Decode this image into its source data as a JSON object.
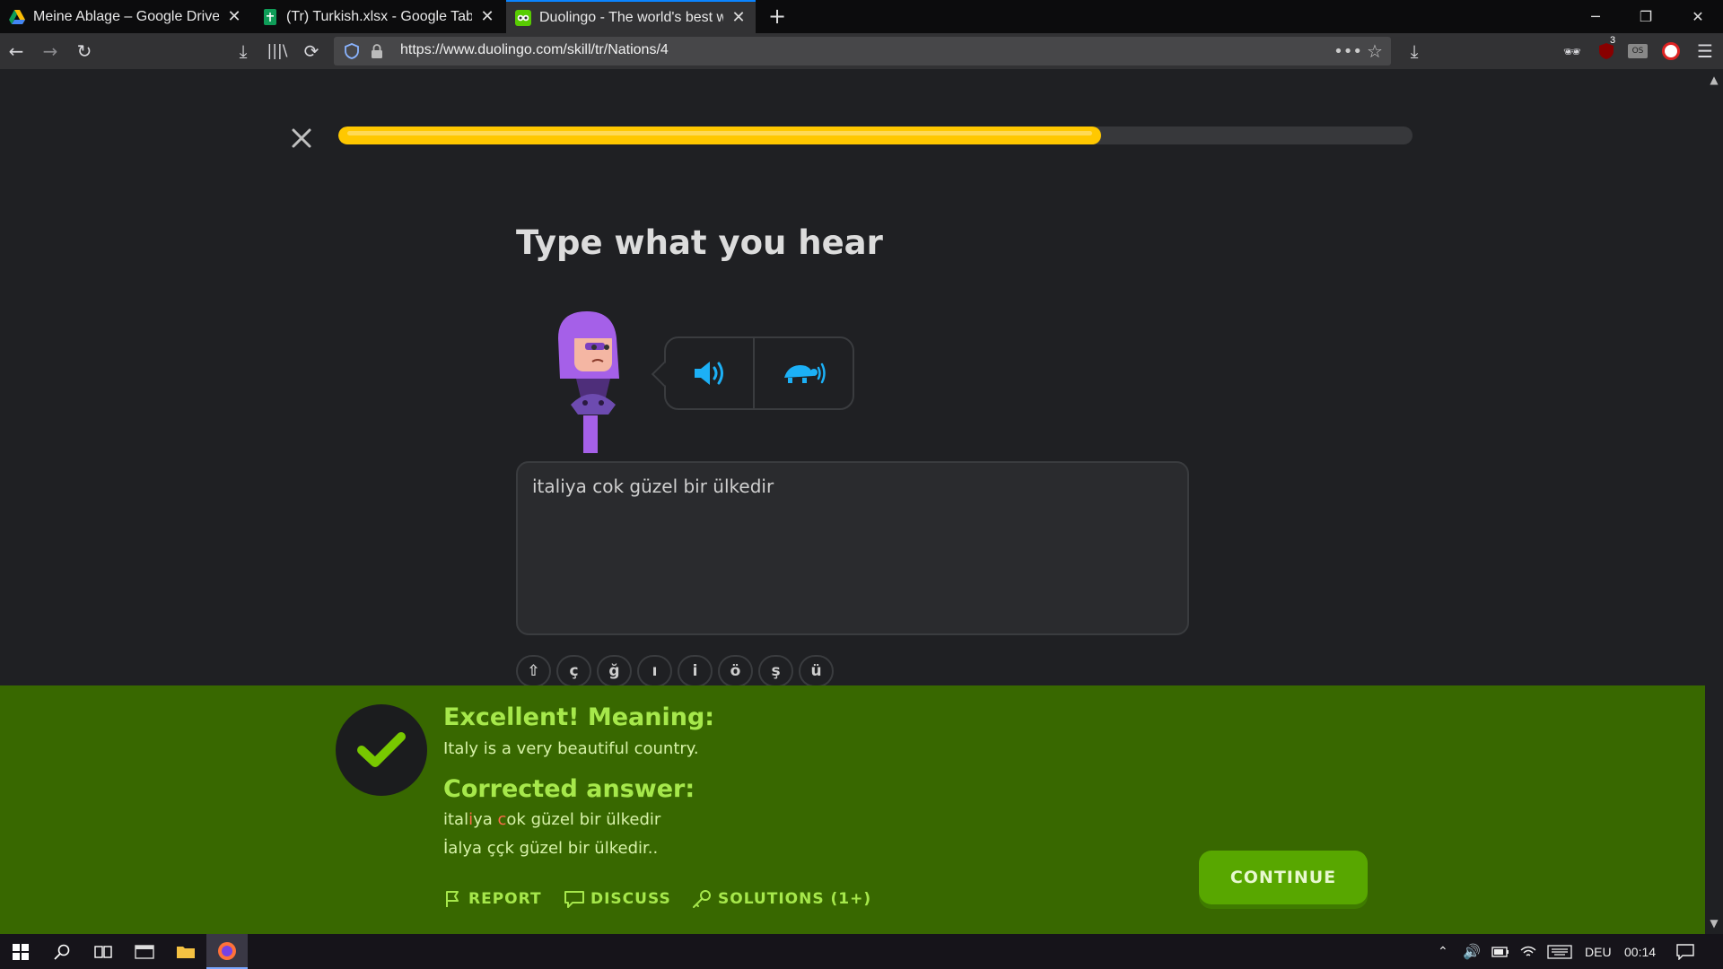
{
  "browser": {
    "tabs": [
      {
        "title": "Meine Ablage – Google Drive",
        "icon": "google-drive-icon"
      },
      {
        "title": "(Tr) Turkish.xlsx - Google Tabell",
        "icon": "google-sheets-icon"
      },
      {
        "title": "Duolingo - The world's best wa",
        "icon": "duolingo-icon",
        "active": true
      }
    ],
    "url": "https://www.duolingo.com/skill/tr/Nations/4",
    "extension_badge": "3"
  },
  "lesson": {
    "progress": 0.71,
    "prompt": "Type what you hear",
    "answer_text": "italiya cok güzel bir ülkedir",
    "special_chars": [
      "⇧",
      "ç",
      "ğ",
      "ı",
      "i",
      "ö",
      "ş",
      "ü"
    ]
  },
  "feedback": {
    "heading": "Excellent! Meaning:",
    "meaning": "Italy is a very beautiful country.",
    "corrected_heading": "Corrected answer:",
    "corrected_parts": [
      "ital",
      "i",
      "ya ",
      "c",
      "ok güzel bir ülkedir"
    ],
    "corrected_line2": "İalya ççk güzel bir ülkedir..",
    "report": "REPORT",
    "discuss": "DISCUSS",
    "solutions": "SOLUTIONS (1+)",
    "continue": "CONTINUE"
  },
  "taskbar": {
    "language": "DEU",
    "time": "00:14"
  },
  "colors": {
    "feedback_bg": "#386800",
    "accent_green": "#a6e84b",
    "progress_yellow": "#ffc800",
    "continue_green": "#58a700",
    "audio_blue": "#1cb0f6"
  }
}
